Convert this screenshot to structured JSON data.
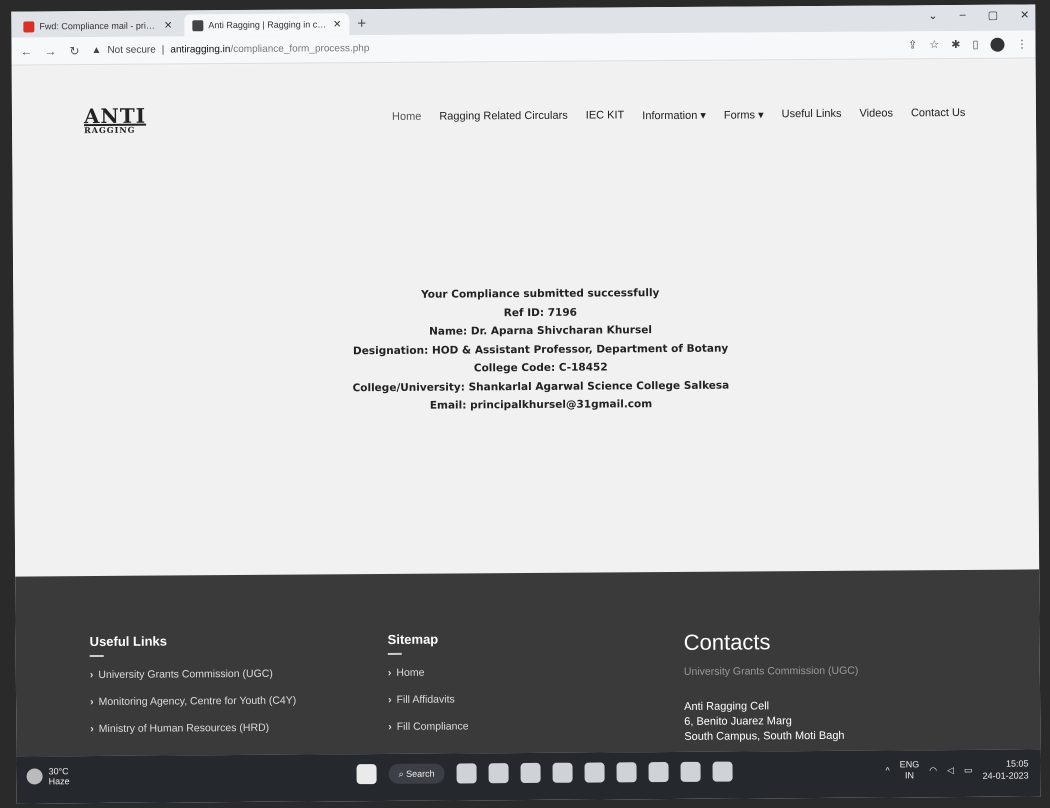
{
  "browser": {
    "tabs": [
      {
        "title": "Fwd: Compliance mail - principal",
        "fav_color": "#d93025",
        "active": false
      },
      {
        "title": "Anti Ragging | Ragging in colle",
        "fav_color": "#444444",
        "active": true
      }
    ],
    "new_tab": "+",
    "address": {
      "security": "Not secure",
      "host": "antiragging.in",
      "path": "/compliance_form_process.php"
    },
    "window_controls": {
      "minimize": "–",
      "maximize": "▢",
      "close": "✕"
    }
  },
  "site": {
    "logo": {
      "line1": "ANTI",
      "line2": "RAGGING"
    },
    "nav": [
      "Home",
      "Ragging Related Circulars",
      "IEC KIT",
      "Information ▾",
      "Forms ▾",
      "Useful Links",
      "Videos",
      "Contact Us"
    ]
  },
  "message": {
    "lines": [
      "Your Compliance submitted successfully",
      "Ref ID: 7196",
      "Name: Dr. Aparna Shivcharan Khursel",
      "Designation: HOD & Assistant Professor, Department of Botany",
      "College Code: C-18452",
      "College/University: Shankarlal Agarwal Science College Salkesa",
      "Email: principalkhursel@31gmail.com"
    ]
  },
  "footer": {
    "useful_links": {
      "heading": "Useful Links",
      "items": [
        "University Grants Commission (UGC)",
        "Monitoring Agency, Centre for Youth (C4Y)",
        "Ministry of Human Resources (HRD)"
      ]
    },
    "sitemap": {
      "heading": "Sitemap",
      "items": [
        "Home",
        "Fill Affidavits",
        "Fill Compliance"
      ]
    },
    "contacts": {
      "heading": "Contacts",
      "ugc": "University Grants Commission (UGC)",
      "address": [
        "Anti Ragging Cell",
        "6, Benito Juarez Marg",
        "South Campus, South Moti Bagh"
      ]
    }
  },
  "taskbar": {
    "weather": {
      "temp": "30°C",
      "desc": "Haze"
    },
    "search": "Search",
    "tray": {
      "lang": "ENG",
      "region": "IN",
      "time": "15:05",
      "date": "24-01-2023"
    }
  }
}
